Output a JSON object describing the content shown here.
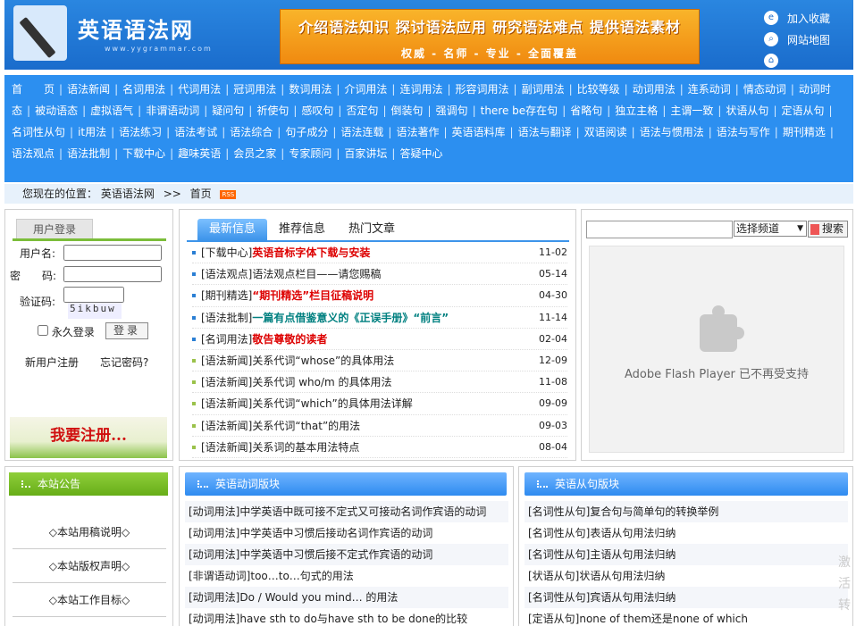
{
  "header": {
    "site_name": "英语语法网",
    "domain": "www.yygrammar.com",
    "banner_top": "介绍语法知识  探讨语法应用  研究语法难点  提供语法素材",
    "banner_bottom": "权威 - 名师 - 专业 - 全面覆盖",
    "links": [
      {
        "label": "加入收藏",
        "icon": "ie-icon"
      },
      {
        "label": "网站地图",
        "icon": "map-icon"
      },
      {
        "label": "",
        "icon": "home-icon"
      }
    ]
  },
  "nav": [
    "首　　页",
    "语法新闻",
    "名词用法",
    "代词用法",
    "冠词用法",
    "数词用法",
    "介词用法",
    "连词用法",
    "形容词用法",
    "副词用法",
    "比较等级",
    "动词用法",
    "连系动词",
    "情态动词",
    "动词时态",
    "被动语态",
    "虚拟语气",
    "非谓语动词",
    "疑问句",
    "祈使句",
    "感叹句",
    "否定句",
    "倒装句",
    "强调句",
    "there be存在句",
    "省略句",
    "独立主格",
    "主谓一致",
    "状语从句",
    "定语从句",
    "名词性从句",
    "it用法",
    "语法练习",
    "语法考试",
    "语法综合",
    "句子成分",
    "语法连载",
    "语法著作",
    "英语语料库",
    "语法与翻译",
    "双语阅读",
    "语法与惯用法",
    "语法与写作",
    "期刊精选",
    "语法观点",
    "语法批制",
    "下载中心",
    "趣味英语",
    "会员之家",
    "专家顾问",
    "百家讲坛",
    "答疑中心"
  ],
  "breadcrumb": {
    "prefix": "您现在的位置：",
    "site": "英语语法网",
    "arrow": ">>",
    "page": "首页",
    "rss": "RSS"
  },
  "login": {
    "tab": "用户登录",
    "username_label": "用户名:",
    "password_label": "密　　码:",
    "captcha_label": "验证码:",
    "captcha_text": "5ikbuw",
    "remember_label": "永久登录",
    "login_button": "登录",
    "register_link": "新用户注册",
    "forgot_link": "忘记密码?",
    "register_banner": "我要注册..."
  },
  "news": {
    "tabs": [
      "最新信息",
      "推荐信息",
      "热门文章"
    ],
    "items": [
      {
        "cat": "[下载中心]",
        "title": "英语音标字体下载与安装",
        "style": "red",
        "date": "11-02",
        "bullet": "b"
      },
      {
        "cat": "[语法观点]",
        "title": "语法观点栏目——请您赐稿",
        "style": "",
        "date": "05-14",
        "bullet": "b"
      },
      {
        "cat": "[期刊精选]",
        "title": "“期刊精选”栏目征稿说明",
        "style": "red",
        "date": "04-30",
        "bullet": "b"
      },
      {
        "cat": "[语法批制]",
        "title": "一篇有点借鉴意义的《正误手册》“前言”",
        "style": "teal",
        "date": "11-14",
        "bullet": "b"
      },
      {
        "cat": "[名词用法]",
        "title": "敬告尊敬的读者",
        "style": "red",
        "date": "02-04",
        "bullet": "b"
      },
      {
        "cat": "[语法新闻]",
        "title": "关系代词“whose”的具体用法",
        "style": "",
        "date": "12-09",
        "bullet": "g"
      },
      {
        "cat": "[语法新闻]",
        "title": "关系代词 who/m 的具体用法",
        "style": "",
        "date": "11-08",
        "bullet": "g"
      },
      {
        "cat": "[语法新闻]",
        "title": "关系代词“which”的具体用法详解",
        "style": "",
        "date": "09-09",
        "bullet": "g"
      },
      {
        "cat": "[语法新闻]",
        "title": "关系代词“that”的用法",
        "style": "",
        "date": "09-03",
        "bullet": "g"
      },
      {
        "cat": "[语法新闻]",
        "title": "关系词的基本用法特点",
        "style": "",
        "date": "08-04",
        "bullet": "g"
      }
    ]
  },
  "search": {
    "select_label": "选择频道",
    "button": "搜索"
  },
  "flash": {
    "message": "Adobe Flash Player 已不再受支持"
  },
  "notice": {
    "title": "本站公告",
    "items": [
      "◇本站用稿说明◇",
      "◇本站版权声明◇",
      "◇本站工作目标◇"
    ]
  },
  "verb_section": {
    "title": "英语动词版块",
    "items": [
      "[动词用法]中学英语中既可接不定式又可接动名词作宾语的动词",
      "[动词用法]中学英语中习惯后接动名词作宾语的动词",
      "[动词用法]中学英语中习惯后接不定式作宾语的动词",
      "[非谓语动词]too…to…句式的用法",
      "[动词用法]Do / Would you mind… 的用法",
      "[动词用法]have sth to do与have sth to be done的比较"
    ]
  },
  "clause_section": {
    "title": "英语从句版块",
    "items": [
      "[名词性从句]复合句与简单句的转换举例",
      "[名词性从句]表语从句用法归纳",
      "[名词性从句]主语从句用法归纳",
      "[状语从句]状语从句用法归纳",
      "[名词性从句]宾语从句用法归纳",
      "[定语从句]none of them还是none of which"
    ]
  },
  "watermark": "激活 转"
}
